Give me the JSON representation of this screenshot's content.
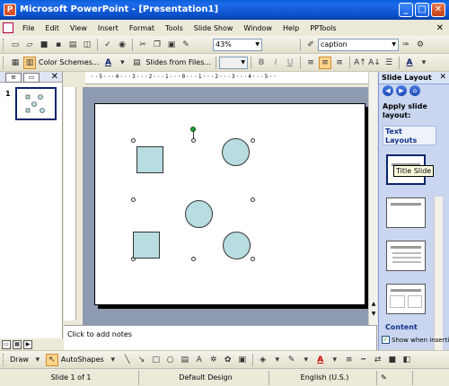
{
  "window": {
    "title": "Microsoft PowerPoint - [Presentation1]",
    "app_icon": "P",
    "minimize_icon": "_",
    "maximize_icon": "□",
    "close_icon": "✕"
  },
  "menu": {
    "items": [
      "File",
      "Edit",
      "View",
      "Insert",
      "Format",
      "Tools",
      "Slide Show",
      "Window",
      "Help",
      "PPTools"
    ],
    "close_icon": "✕"
  },
  "standard_toolbar": {
    "zoom_value": "43%",
    "font_value": "caption"
  },
  "formatting_toolbar": {
    "color_schemes_label": "Color Schemes...",
    "slides_from_files_label": "Slides from Files...",
    "bold": "B",
    "italic": "I",
    "underline": "U"
  },
  "left_pane": {
    "slide_number": "1",
    "close_icon": "✕"
  },
  "notes": {
    "placeholder": "Click to add notes"
  },
  "task_pane": {
    "title": "Slide Layout",
    "close_icon": "✕",
    "apply_label": "Apply slide layout:",
    "section_text_layouts": "Text Layouts",
    "tooltip": "Title Slide",
    "section_content": "Content",
    "show_when_inserting": "Show when inserting"
  },
  "drawing_toolbar": {
    "draw_label": "Draw",
    "autoshapes_label": "AutoShapes"
  },
  "status_bar": {
    "slide_info": "Slide 1 of 1",
    "design": "Default Design",
    "language": "English (U.S.)"
  },
  "ruler": {
    "h_labels": "··5···4···3···2···1···0···1···2···3···4···5··"
  },
  "slide_shapes": [
    {
      "kind": "square"
    },
    {
      "kind": "circle"
    },
    {
      "kind": "circle"
    },
    {
      "kind": "square"
    },
    {
      "kind": "circle"
    }
  ],
  "colors": {
    "title_bar": "#0a5fd8",
    "shape_fill": "#b7dde1",
    "task_pane_bg": "#cad6ef",
    "rotation_handle": "#1d9d3c"
  }
}
